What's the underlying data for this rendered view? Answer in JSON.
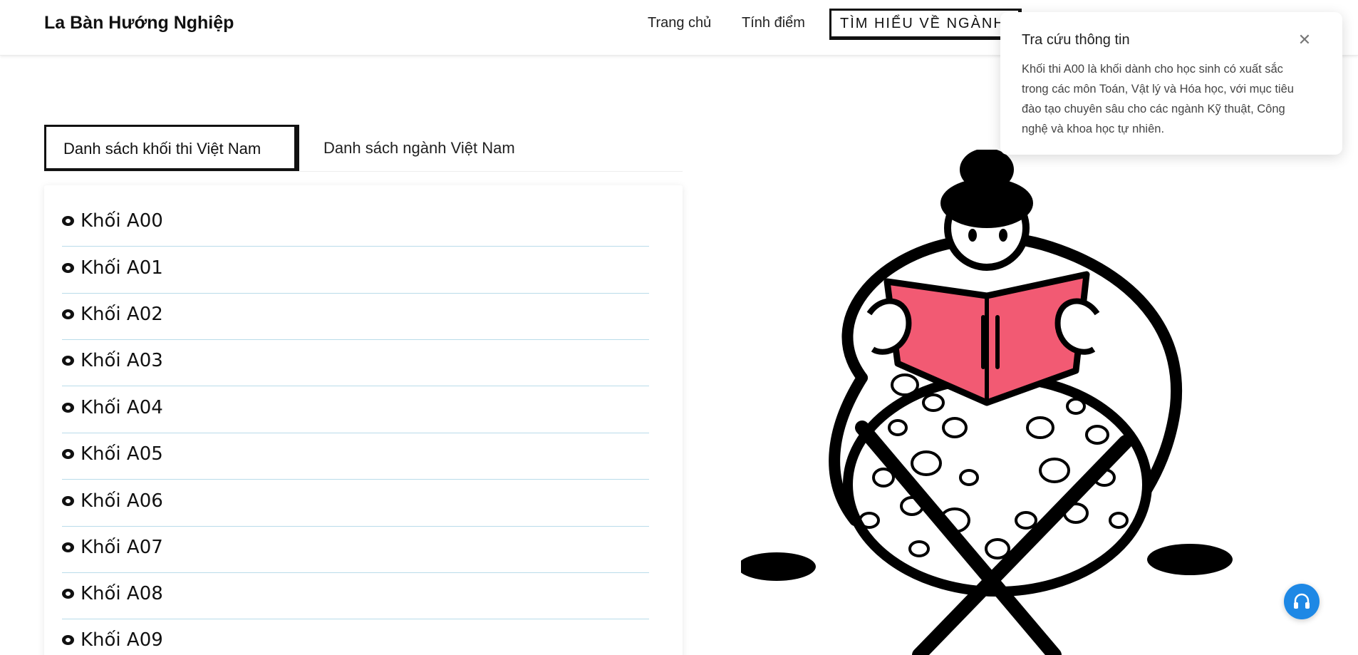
{
  "header": {
    "brand": "La Bàn Hướng Nghiệp",
    "nav": {
      "home": "Trang chủ",
      "score": "Tính điểm",
      "explore": "TÌM HIỂU VỀ NGÀNH"
    }
  },
  "tabs": {
    "active": "Danh sách khối thi Việt Nam",
    "second": "Danh sách ngành Việt Nam"
  },
  "list": {
    "items": [
      "Khối A00",
      "Khối A01",
      "Khối A02",
      "Khối A03",
      "Khối A04",
      "Khối A05",
      "Khối A06",
      "Khối A07",
      "Khối A08",
      "Khối A09"
    ],
    "item_icon": "eye-icon"
  },
  "toast": {
    "title": "Tra cứu thông tin",
    "body": "Khối thi A00 là khối dành cho học sinh có xuất sắc trong các môn Toán, Vật lý và Hóa học, với mục tiêu đào tạo chuyên sâu cho các ngành Kỹ thuật, Công nghệ và khoa học tự nhiên.",
    "close_icon": "close-icon"
  },
  "support": {
    "icon": "headset-icon"
  },
  "colors": {
    "accent": "#1e88e5",
    "book": "#f25a73",
    "divider": "#b9dcea"
  }
}
